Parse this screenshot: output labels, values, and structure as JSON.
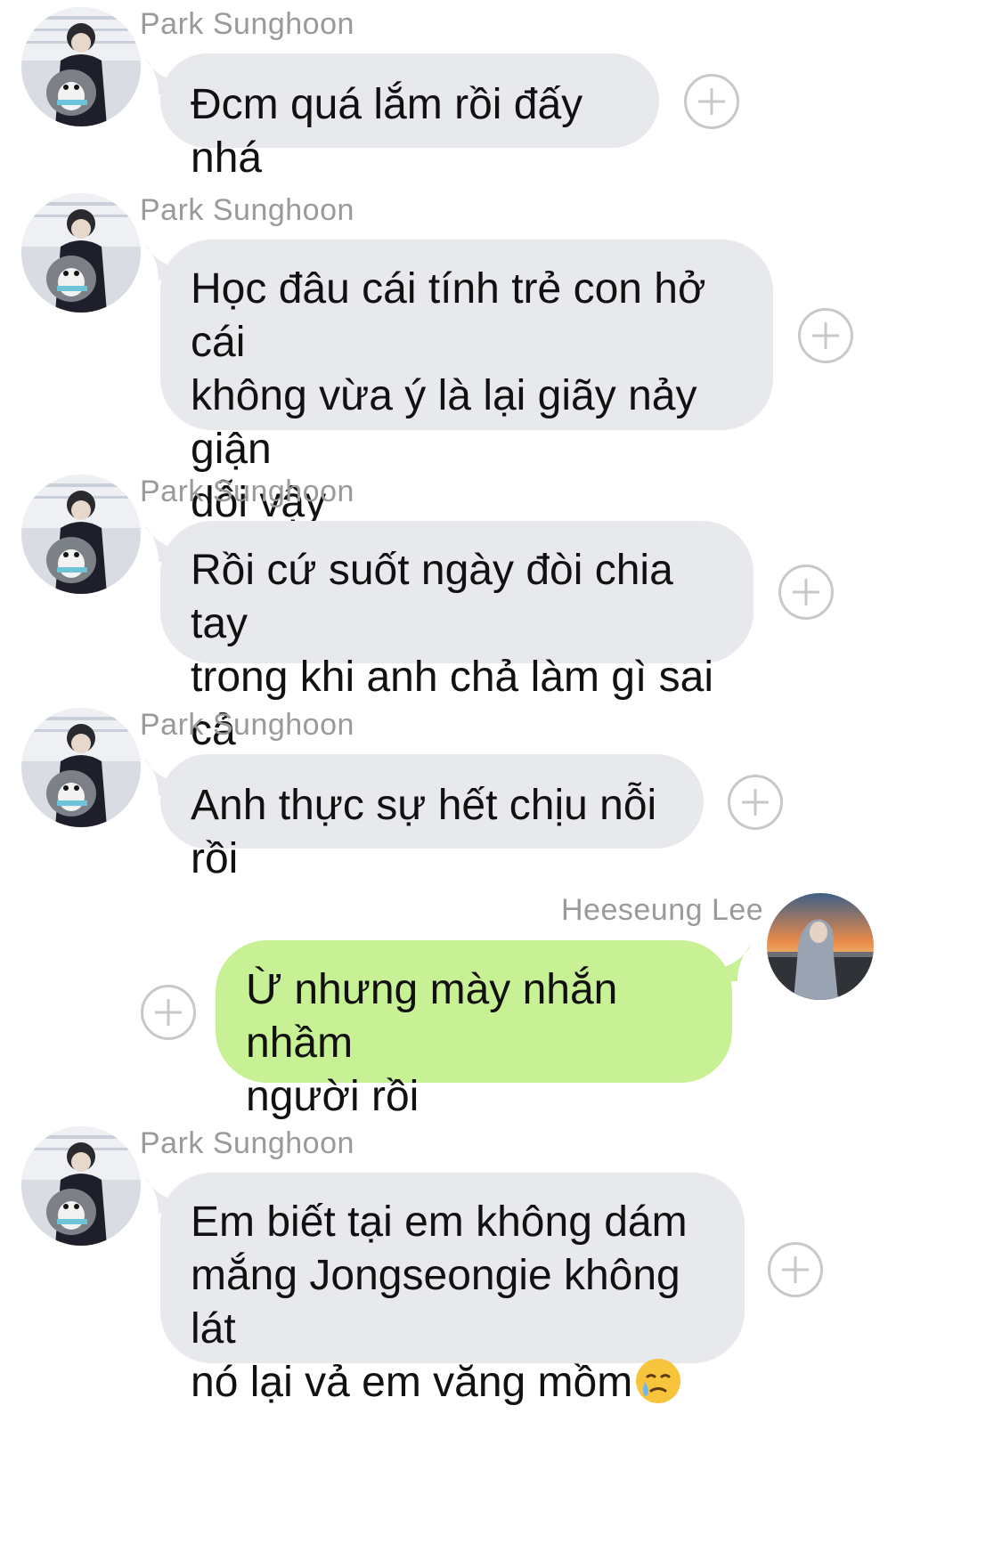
{
  "messages": [
    {
      "sender": "Park Sunghoon",
      "avatar_icon": "avatar-penguin-icon",
      "side": "in",
      "text": "Đcm quá lắm rồi đấy nhá"
    },
    {
      "sender": "Park Sunghoon",
      "avatar_icon": "avatar-penguin-icon",
      "side": "in",
      "text": "Học đâu cái tính trẻ con hở cái\nkhông vừa ý là lại giãy nảy giận\ndỗi vậy"
    },
    {
      "sender": "Park Sunghoon",
      "avatar_icon": "avatar-penguin-icon",
      "side": "in",
      "text": "Rồi cứ suốt ngày đòi chia tay\ntrong khi anh chả làm gì sai cả"
    },
    {
      "sender": "Park Sunghoon",
      "avatar_icon": "avatar-penguin-icon",
      "side": "in",
      "text": "Anh thực sự hết chịu nỗi rồi"
    },
    {
      "sender": "Heeseung Lee",
      "avatar_icon": "avatar-hoodie-sunset-icon",
      "side": "out",
      "text": "Ừ nhưng mày nhắn nhầm\nngười rồi"
    },
    {
      "sender": "Park Sunghoon",
      "avatar_icon": "avatar-penguin-icon",
      "side": "in",
      "text": "Em biết tại em không dám\nmắng Jongseongie không lát\nnó lại vả em văng mồm",
      "emoji": "crying-face-emoji-icon"
    }
  ],
  "colors": {
    "incoming_bubble": "#e8e9ec",
    "outgoing_bubble": "#c8f196",
    "sender_name": "#9a9a9a",
    "plus_icon": "#c8c8cc"
  },
  "icons": {
    "reaction": "plus-circle-icon"
  }
}
